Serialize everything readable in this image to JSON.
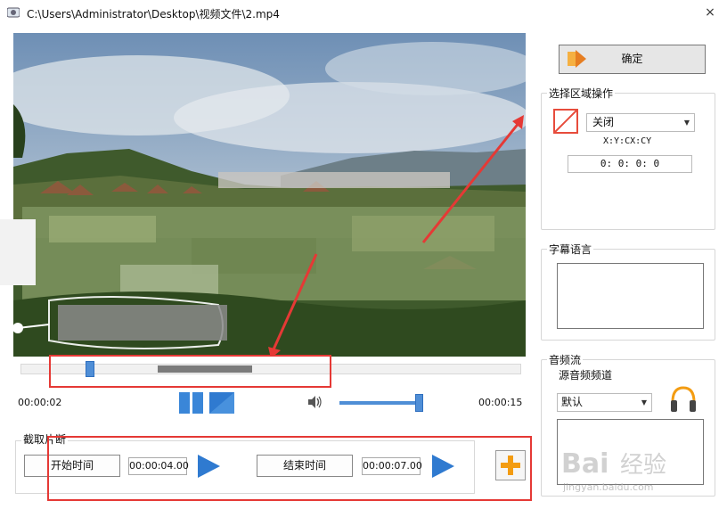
{
  "window": {
    "title": "C:\\Users\\Administrator\\Desktop\\视频文件\\2.mp4",
    "close_glyph": "×"
  },
  "player": {
    "current_time": "00:00:02",
    "total_time": "00:00:15",
    "timeline_position": 0.13,
    "selected_range": [
      0.28,
      0.46
    ],
    "volume": 0.95
  },
  "clip": {
    "group_label": "截取片断",
    "start_label": "开始时间",
    "start_value": "00:00:04.00",
    "end_label": "结束时间",
    "end_value": "00:00:07.00"
  },
  "sidebar": {
    "confirm_label": "确定",
    "region": {
      "title": "选择区域操作",
      "select_value": "关闭",
      "coord_label": "X:Y:CX:CY",
      "coord_value": "0:  0:  0:  0"
    },
    "subtitle": {
      "title": "字幕语言"
    },
    "audio": {
      "title": "音频流",
      "sub_label": "源音频频道",
      "select_value": "默认"
    }
  },
  "colors": {
    "accent": "#4f8ed6",
    "highlight": "#e53935",
    "add_button": "#f39c12"
  },
  "watermark": {
    "brand": "Bai",
    "brand_cn": "经验",
    "url": "jingyan.baidu.com"
  }
}
